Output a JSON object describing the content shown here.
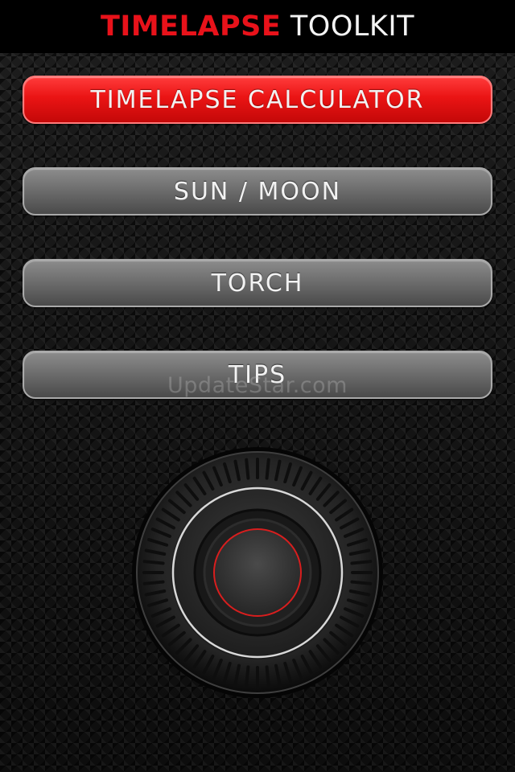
{
  "header": {
    "title_accent": "TIMELAPSE",
    "title_rest": "TOOLKIT"
  },
  "menu": {
    "items": [
      {
        "label": "TIMELAPSE  CALCULATOR",
        "active": true
      },
      {
        "label": "SUN  /  MOON",
        "active": false
      },
      {
        "label": "TORCH",
        "active": false
      },
      {
        "label": "TIPS",
        "active": false
      }
    ]
  },
  "watermark": "UpdateStar.com",
  "dial": {
    "icon": "rotary-dial-icon"
  },
  "colors": {
    "accent": "#e8121a",
    "button_grey": "#6e6e6e",
    "dial_ring": "#d8d8d8",
    "dial_center_ring": "#d81e1e"
  }
}
